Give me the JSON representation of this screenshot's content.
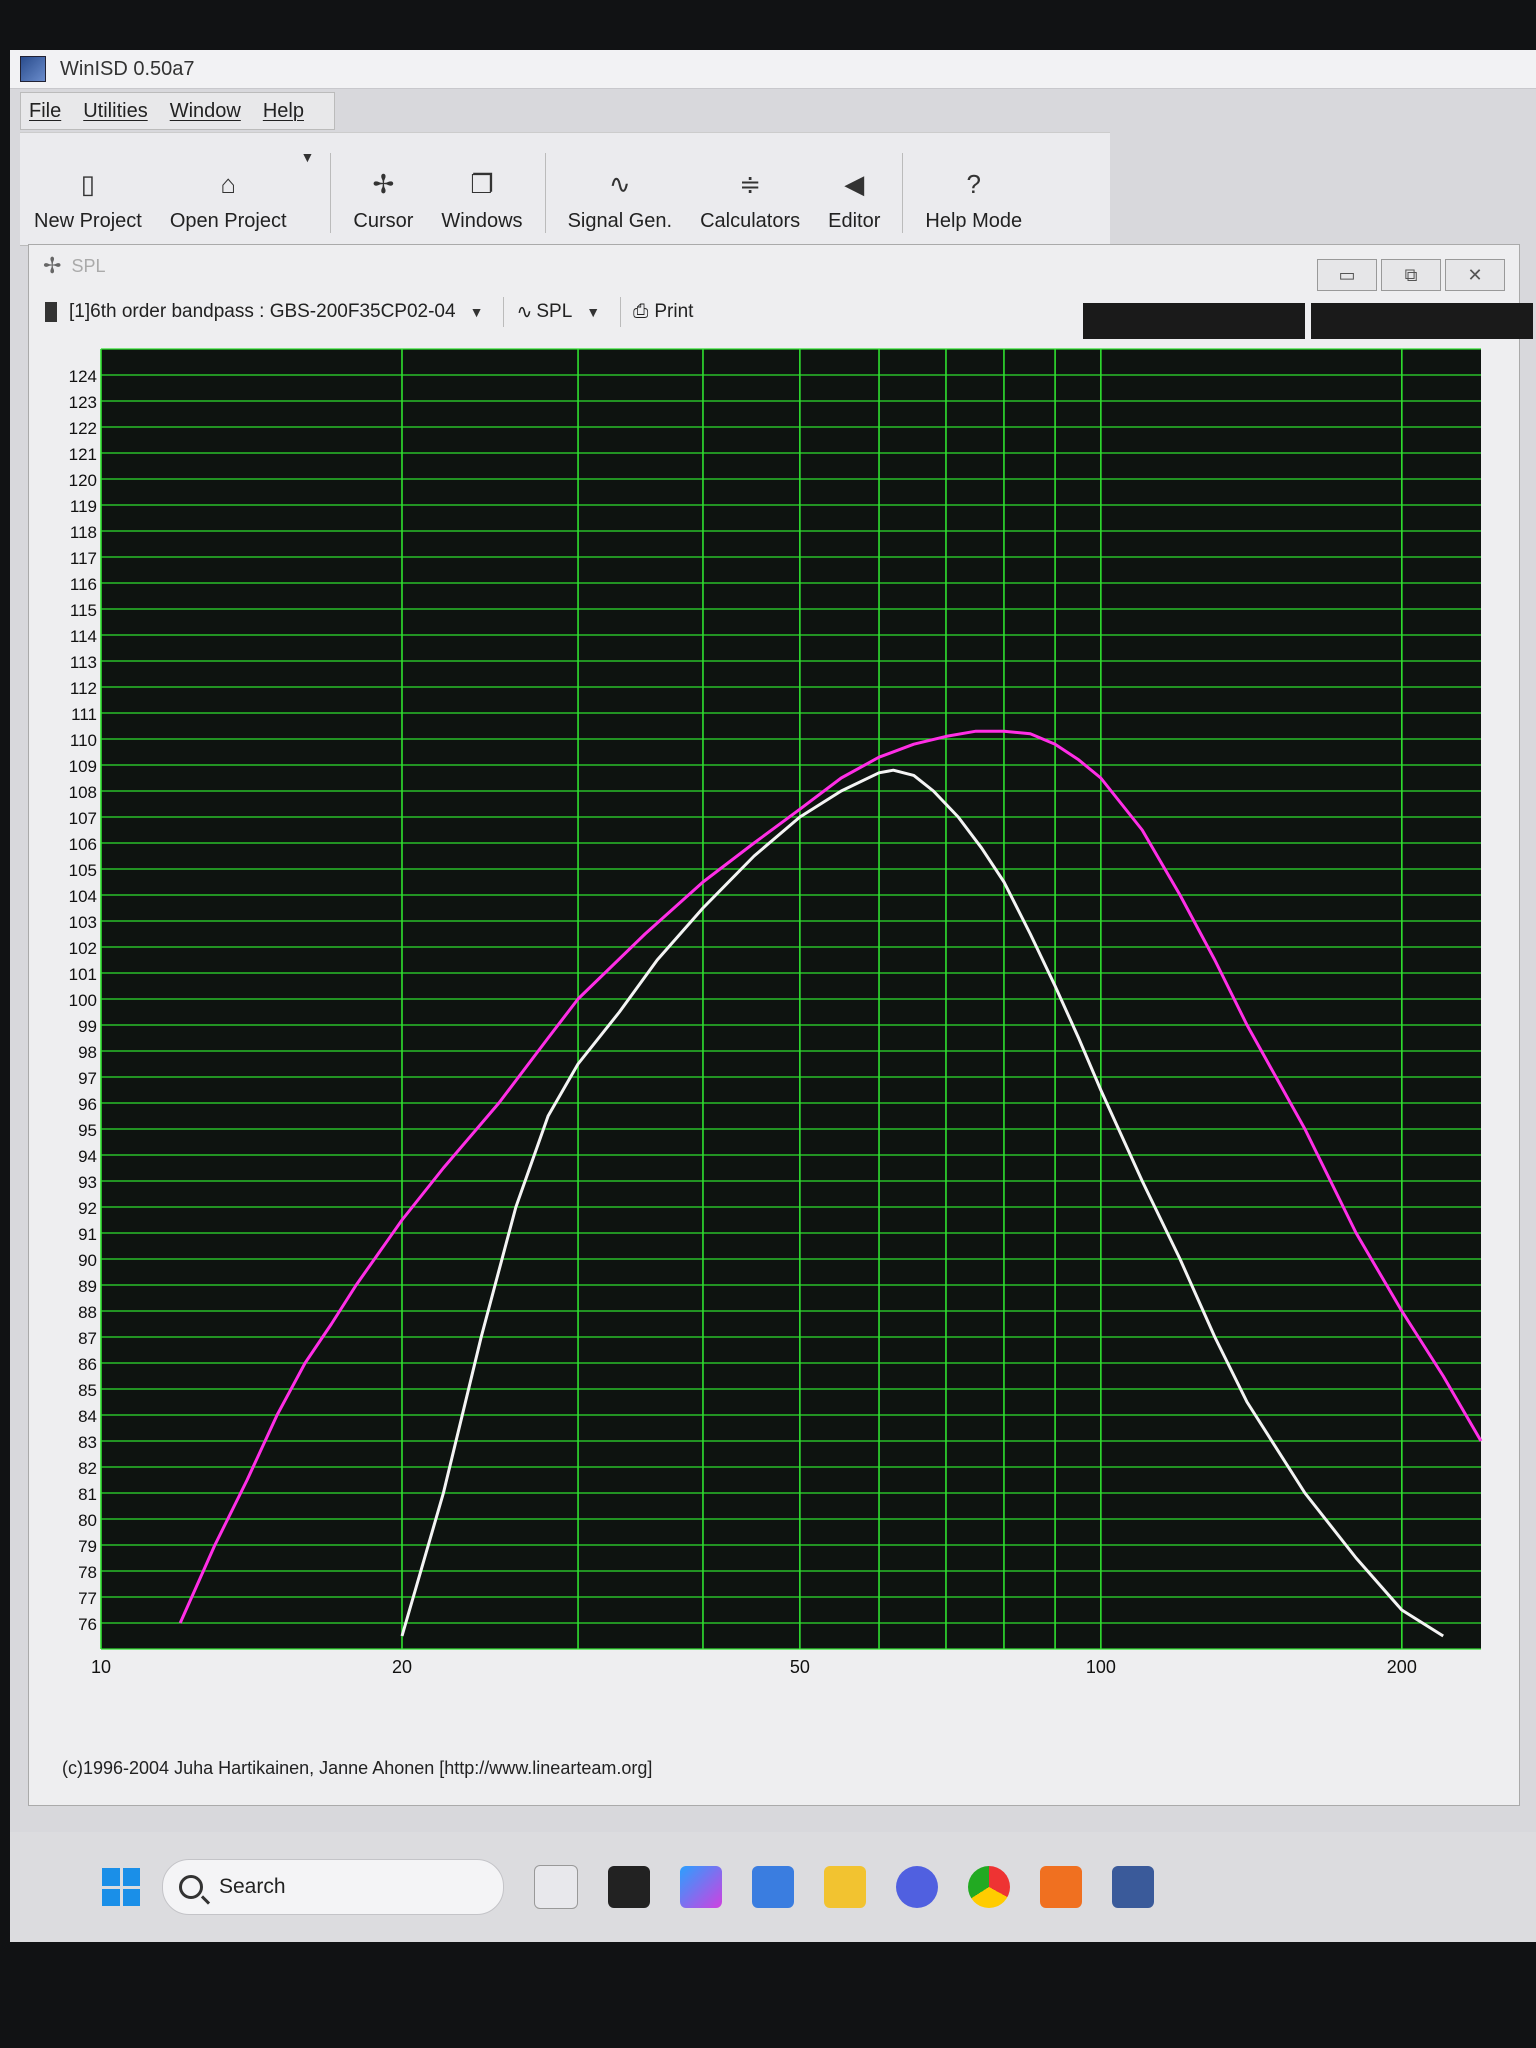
{
  "app": {
    "title": "WinISD 0.50a7"
  },
  "menu": [
    "File",
    "Utilities",
    "Window",
    "Help"
  ],
  "toolbar": [
    {
      "label": "New Project",
      "icon": "new-project-icon",
      "glyph": "▯"
    },
    {
      "label": "Open Project",
      "icon": "open-folder-icon",
      "glyph": "⌂"
    },
    {
      "label": "Cursor",
      "icon": "cursor-icon",
      "glyph": "✢"
    },
    {
      "label": "Windows",
      "icon": "windows-icon",
      "glyph": "❐"
    },
    {
      "label": "Signal Gen.",
      "icon": "sine-wave-icon",
      "glyph": "∿"
    },
    {
      "label": "Calculators",
      "icon": "calculator-icon",
      "glyph": "≑"
    },
    {
      "label": "Editor",
      "icon": "speaker-icon",
      "glyph": "◀"
    },
    {
      "label": "Help Mode",
      "icon": "help-icon",
      "glyph": "?"
    }
  ],
  "child_window": {
    "title": "SPL",
    "project_select": "[1]6th order bandpass : GBS-200F35CP02-04",
    "graph_select": "SPL",
    "print_label": "Print"
  },
  "footer": "(c)1996-2004 Juha Hartikainen, Janne Ahonen [http://www.linearteam.org]",
  "taskbar": {
    "search_label": "Search"
  },
  "colors": {
    "plot_bg": "#0e1310",
    "grid": "#2fe02f",
    "magenta": "#ff2ee6",
    "white": "#f4f4f4"
  },
  "chart_data": {
    "type": "line",
    "x_scale": "log",
    "xlim": [
      10,
      240
    ],
    "ylim": [
      75,
      125
    ],
    "x_ticks": [
      10,
      20,
      50,
      100,
      200
    ],
    "y_ticks": [
      76,
      77,
      78,
      79,
      80,
      81,
      82,
      83,
      84,
      85,
      86,
      87,
      88,
      89,
      90,
      91,
      92,
      93,
      94,
      95,
      96,
      97,
      98,
      99,
      100,
      101,
      102,
      103,
      104,
      105,
      106,
      107,
      108,
      109,
      110,
      111,
      112,
      113,
      114,
      115,
      116,
      117,
      118,
      119,
      120,
      121,
      122,
      123,
      124
    ],
    "grid": true,
    "series": [
      {
        "color": "#ff2ee6",
        "x": [
          12,
          13,
          14,
          15,
          16,
          17,
          18,
          20,
          22,
          25,
          28,
          30,
          35,
          40,
          45,
          50,
          55,
          60,
          65,
          70,
          75,
          80,
          85,
          90,
          95,
          100,
          110,
          120,
          130,
          140,
          160,
          180,
          200,
          220,
          240
        ],
        "y": [
          76,
          79,
          81.5,
          84,
          86,
          87.5,
          89,
          91.5,
          93.5,
          96,
          98.5,
          100,
          102.5,
          104.5,
          106,
          107.3,
          108.5,
          109.3,
          109.8,
          110.1,
          110.3,
          110.3,
          110.2,
          109.8,
          109.2,
          108.5,
          106.5,
          104,
          101.5,
          99,
          95,
          91,
          88,
          85.5,
          83
        ]
      },
      {
        "color": "#f4f4f4",
        "x": [
          20,
          22,
          24,
          26,
          28,
          30,
          33,
          36,
          40,
          45,
          50,
          55,
          60,
          62,
          65,
          68,
          72,
          76,
          80,
          85,
          90,
          95,
          100,
          110,
          120,
          130,
          140,
          160,
          180,
          200,
          220
        ],
        "y": [
          75.5,
          81,
          87,
          92,
          95.5,
          97.5,
          99.5,
          101.5,
          103.5,
          105.5,
          107,
          108,
          108.7,
          108.8,
          108.6,
          108,
          107,
          105.8,
          104.5,
          102.5,
          100.5,
          98.5,
          96.5,
          93,
          90,
          87,
          84.5,
          81,
          78.5,
          76.5,
          75.5
        ]
      }
    ]
  }
}
